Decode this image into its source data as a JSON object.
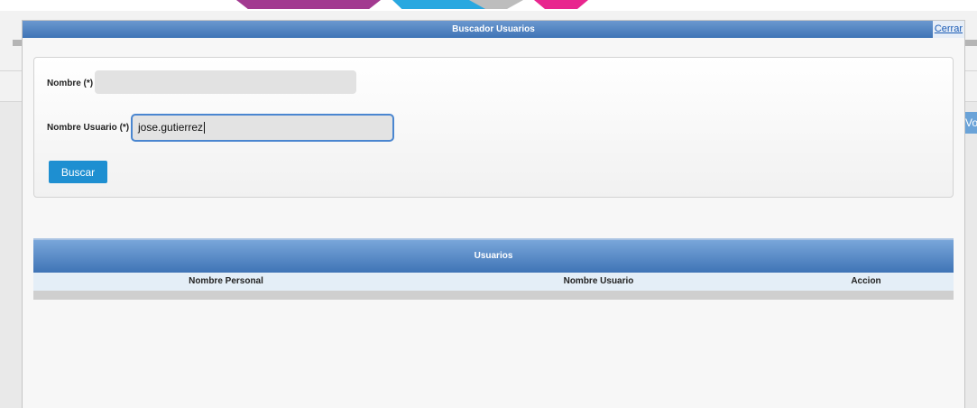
{
  "modal": {
    "title": "Buscador Usuarios",
    "close_label": "Cerrar"
  },
  "form": {
    "nombre_label": "Nombre (*)",
    "nombre_value": "",
    "usuario_label": "Nombre Usuario (*)",
    "usuario_value": "jose.gutierrez",
    "search_button": "Buscar"
  },
  "results": {
    "title": "Usuarios",
    "columns": [
      "Nombre Personal",
      "Nombre Usuario",
      "Accion"
    ]
  },
  "background": {
    "side_button_label": "Vo"
  },
  "colors": {
    "header_blue": "#3f74b6",
    "button_blue": "#1e8fd1",
    "focus_border": "#4a86d0"
  }
}
